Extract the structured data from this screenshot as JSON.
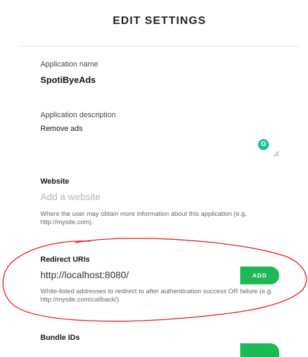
{
  "page": {
    "title": "EDIT SETTINGS"
  },
  "app_name": {
    "label": "Application name",
    "value": "SpotiByeAds"
  },
  "app_description": {
    "label": "Application description",
    "value": "Remove ads"
  },
  "website": {
    "label": "Website",
    "placeholder": "Add a website",
    "help": "Where the user may obtain more information about this application (e.g. http://mysite.com)."
  },
  "redirect": {
    "label": "Redirect URIs",
    "value": "http://localhost:8080/",
    "add_label": "ADD",
    "help": "White-listed addresses to redirect to after authentication success OR failure (e.g. http://mysite.com/callback/)"
  },
  "bundle": {
    "label": "Bundle IDs"
  },
  "colors": {
    "accent": "#1db954",
    "annotation": "#e8151b",
    "grammarly": "#15c39a"
  },
  "icons": {
    "grammarly": "grammarly-icon",
    "resize": "resize-handle-icon"
  }
}
